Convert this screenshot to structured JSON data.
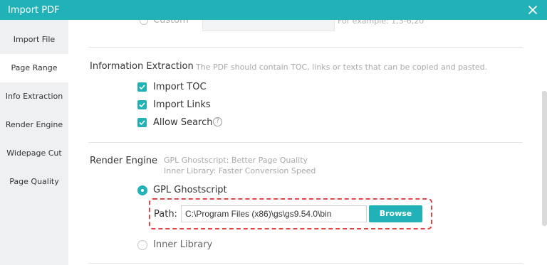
{
  "window": {
    "title": "Import PDF",
    "close_icon": "close-icon"
  },
  "sidebar": {
    "items": [
      {
        "label": "Import File"
      },
      {
        "label": "Page Range"
      },
      {
        "label": "Info Extraction"
      },
      {
        "label": "Render Engine"
      },
      {
        "label": "Widepage Cut"
      },
      {
        "label": "Page Quality"
      }
    ],
    "active_index": 1
  },
  "page_range": {
    "custom_label": "Custom",
    "custom_value": "",
    "hint": "For example: 1,3-6,20"
  },
  "info_extraction": {
    "title": "Information Extraction",
    "hint": "The PDF should contain TOC, links or texts that can be copied and pasted.",
    "options": [
      {
        "label": "Import TOC",
        "checked": true
      },
      {
        "label": "Import Links",
        "checked": true
      },
      {
        "label": "Allow Search",
        "checked": true
      }
    ],
    "help_icon": "question-circle-icon",
    "help_glyph": "?"
  },
  "render_engine": {
    "title": "Render Engine",
    "hint_line1": "GPL Ghostscript: Better Page Quality",
    "hint_line2": "Inner Library: Faster Conversion Speed",
    "options": [
      {
        "label": "GPL Ghostscript",
        "selected": true
      },
      {
        "label": "Inner Library",
        "selected": false
      }
    ],
    "path_label": "Path:",
    "path_value": "C:\\Program Files (x86)\\gs\\gs9.54.0\\bin",
    "browse_label": "Browse"
  },
  "colors": {
    "accent": "#21b2b7",
    "highlight_dashed": "#e04848"
  }
}
